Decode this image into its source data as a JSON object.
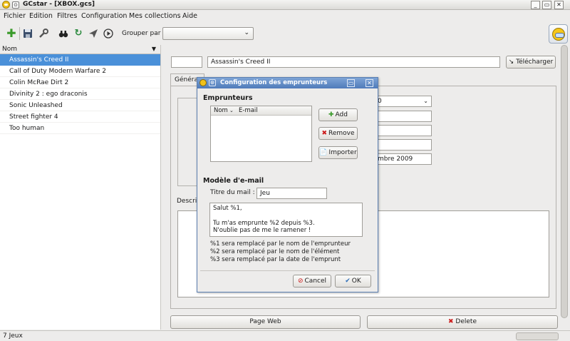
{
  "window": {
    "title": "GCstar - [XBOX.gcs]",
    "minimize": "_",
    "maximize": "▭",
    "close": "✕"
  },
  "menu": [
    "Fichier",
    "Edition",
    "Filtres",
    "Configuration",
    "Mes collections",
    "Aide"
  ],
  "toolbar": {
    "group_label": "Grouper par",
    "group_value": ""
  },
  "list": {
    "header": "Nom",
    "items": [
      "Assassin's Creed II",
      "Call of Duty Modern Warfare 2",
      "Colin McRae Dirt 2",
      "Divinity 2 : ego draconis",
      "Sonic Unleashed",
      "Street fighter 4",
      "Too human"
    ],
    "selected_index": 0
  },
  "status": {
    "count": "7 Jeux"
  },
  "details": {
    "title_value": "Assassin's Creed II",
    "download_button": "Télécharger",
    "tab_general": "Généra",
    "date_fragment": "mbre 2009",
    "combo_fragment": "0",
    "description_label": "Descri",
    "web_button": "Page Web",
    "delete_button": "Delete"
  },
  "dialog": {
    "title": "Configuration des emprunteurs",
    "borrowers_section": "Emprunteurs",
    "col_name": "Nom",
    "col_email": "E-mail",
    "add_button": "Add",
    "remove_button": "Remove",
    "import_button": "Importer",
    "email_section": "Modèle d'e-mail",
    "mail_title_label": "Titre du mail :",
    "mail_title_value": "Jeu",
    "mail_body": [
      "Salut %1,",
      "",
      "Tu m'as emprunte %2 depuis %3.",
      "N'oublie pas de me le ramener !"
    ],
    "help": [
      "%1 sera remplacé par le nom de l'emprunteur",
      "%2 sera remplacé par le nom de l'élément",
      "%3 sera remplacé par la date de l'emprunt"
    ],
    "cancel_button": "Cancel",
    "ok_button": "OK"
  },
  "colors": {
    "selection": "#4a90d9",
    "dialog_title": "#4f7bba",
    "add_icon": "#3a9a2a",
    "delete_icon": "#cc1b1b"
  }
}
